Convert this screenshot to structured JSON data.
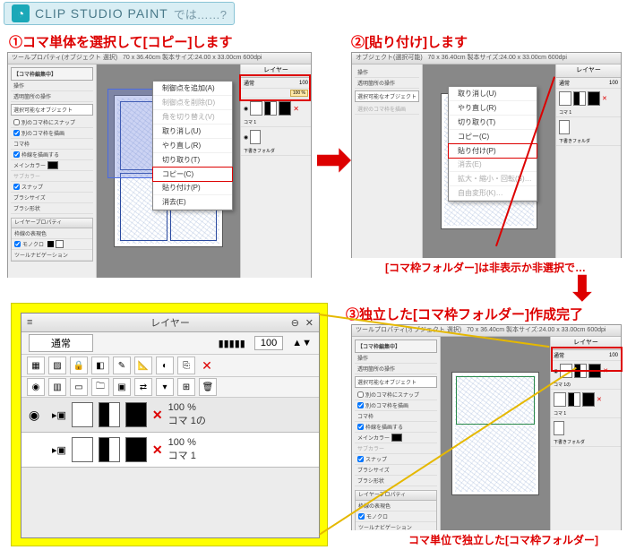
{
  "header": {
    "logo_glyph": "◔",
    "title": "CLIP STUDIO PAINT",
    "sub": "では……?"
  },
  "steps": {
    "s1": {
      "num": "①",
      "text": "コマ単体を選択して[コピー]します"
    },
    "s2": {
      "num": "②",
      "text": "[貼り付け]します"
    },
    "s3": {
      "num": "③",
      "text": "独立した[コマ枠フォルダー]作成完了"
    }
  },
  "panel_common": {
    "topbar": "70 x 36.40cm 製本サイズ:24.00 x 33.00cm 600dpi",
    "tool_prop_title": "ツールプロパティ(オブジェクト 選択)",
    "tool_prop_title2": "オブジェクト(選択可能)",
    "frame_edit_title": "【コマ枠編集中】",
    "ops_label": "操作",
    "transparent_ops": "透明箇所の操作",
    "selectable_obj": "選択可能なオブジェクト",
    "snap_other": "別のコマ枠にスナップ",
    "draw_other": "別のコマ枠を描画",
    "frame_border": "コマ枠",
    "draw_border": "枠線を描画する",
    "main_color": "メインカラー",
    "sub_color": "サブカラー",
    "snap": "スナップ",
    "brush_size": "ブラシサイズ",
    "brush_shape": "ブラシ形状",
    "layer_prop": "レイヤープロパティ",
    "border_effect": "枠線の表現色",
    "mono": "モノクロ",
    "tool_nav": "ツールナビゲーション",
    "layer": "レイヤー",
    "normal": "通常",
    "opacity": "100",
    "pct": "100 %",
    "frame1": "コマ 1",
    "frame1_layer": "コマ 1の",
    "sketch_folder": "下書きフォルダ"
  },
  "context_menu1": {
    "items": [
      {
        "t": "制御点を追加(A)"
      },
      {
        "t": "制御点を削除(D)",
        "dim": true
      },
      {
        "t": "角を切り替え(V)",
        "dim": true
      },
      {
        "t": "取り消し(U)"
      },
      {
        "t": "やり直し(R)"
      },
      {
        "t": "切り取り(T)"
      },
      {
        "t": "コピー(C)",
        "hl": true
      },
      {
        "t": "貼り付け(P)"
      },
      {
        "t": "消去(E)"
      }
    ]
  },
  "context_menu2": {
    "items": [
      {
        "t": "取り消し(U)"
      },
      {
        "t": "やり直し(R)"
      },
      {
        "t": "切り取り(T)"
      },
      {
        "t": "コピー(C)"
      },
      {
        "t": "貼り付け(P)",
        "hl": true
      },
      {
        "t": "消去(E)",
        "dim": true
      },
      {
        "t": "拡大・縮小・回転(S)…",
        "dim": true
      },
      {
        "t": "自由変形(K)…",
        "dim": true
      }
    ]
  },
  "notes": {
    "hide_note": "[コマ枠フォルダー]は非表示か非選択で…",
    "final_note": "コマ単位で独立した[コマ枠フォルダー]"
  },
  "zoom": {
    "title": "レイヤー",
    "mode": "通常",
    "opacity": "100",
    "row1_pct": "100 %",
    "row1_name": "コマ 1の",
    "row2_pct": "100 %",
    "row2_name": "コマ 1"
  }
}
